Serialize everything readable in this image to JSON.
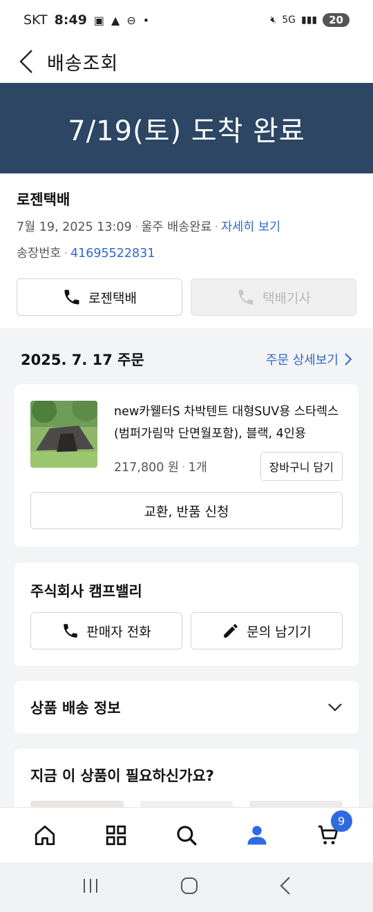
{
  "status_bar": {
    "carrier": "SKT",
    "time": "8:49",
    "network": "5G",
    "battery": "20",
    "colors": {
      "battery_bg": "#555555"
    }
  },
  "header": {
    "title": "배송조회",
    "back_icon": "chevron-left-icon"
  },
  "banner": {
    "text": "7/19(토) 도착 완료",
    "bg_color": "#2c4664"
  },
  "delivery": {
    "courier": "로젠택배",
    "datetime": "7월 19, 2025 13:09",
    "location_status": "울주 배송완료",
    "detail_link": "자세히 보기",
    "tracking_label": "송장번호",
    "tracking_number": "41695522831",
    "courier_call_label": "로젠택배",
    "driver_call_label": "택배기사"
  },
  "order": {
    "date": "2025. 7. 17 주문",
    "detail_link": "주문 상세보기"
  },
  "product": {
    "name": "new카웰터S 차박텐트 대형SUV용 스타렉스 (범퍼가림막 단면월포함), 블랙, 4인용",
    "price": "217,800 원",
    "quantity": "1개",
    "cart_button": "장바구니 담기",
    "exchange_button": "교환, 반품 신청"
  },
  "seller": {
    "name": "주식회사 캠프밸리",
    "call_button": "판매자 전화",
    "inquiry_button": "문의 남기기"
  },
  "shipping_info": {
    "title": "상품 배송 정보"
  },
  "recommend": {
    "title": "지금 이 상품이 필요하신가요?"
  },
  "bottom_nav": {
    "cart_count": "9",
    "active_color": "#2f6ae0",
    "items": [
      "home-icon",
      "categories-icon",
      "search-icon",
      "my-page-icon",
      "cart-icon"
    ]
  },
  "accent_color": "#2f67c9"
}
